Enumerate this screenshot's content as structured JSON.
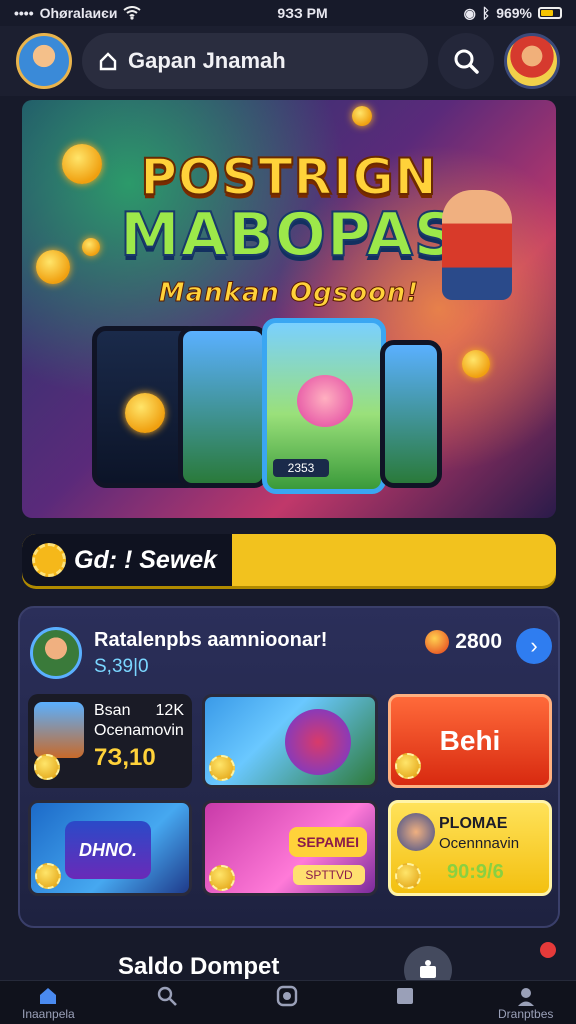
{
  "status": {
    "carrier": "Ohøralaиєи",
    "time": "9ЗЗ PM",
    "battery": "969%"
  },
  "header": {
    "title": "Gapan Jnamah"
  },
  "banner": {
    "line1": "POSTRIGN",
    "line2": "MABOPAS",
    "line3": "Mankan Ogsoon!",
    "phone_label": "2353"
  },
  "promo_bar": {
    "label": "Gd: ! Sewek"
  },
  "panel": {
    "promo_title": "Ratalenpbs aamnioonar!",
    "promo_sub": "S,39|0",
    "coins": "2800",
    "tiles": {
      "a_title": "Bsan",
      "a_count": "12K",
      "a_sub": "Ocenamovin",
      "a_value": "7З,10",
      "c_label": "Behi",
      "d_label": "DHNO.",
      "e_title": "SEPAMEI",
      "e_sub": "SPTTVD",
      "f_title": "PLOMAE",
      "f_sub": "Ocennnavin",
      "f_value": "90:9/6"
    }
  },
  "bottom": {
    "saldo": "Saldo Dompet"
  },
  "nav": {
    "home": "Inaanpela",
    "last": "Dranptbes"
  }
}
